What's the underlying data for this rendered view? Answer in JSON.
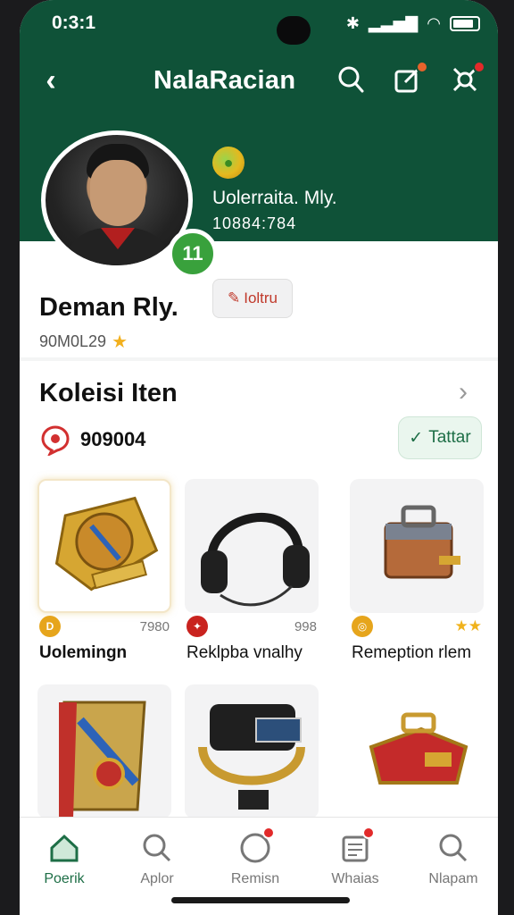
{
  "status_bar": {
    "time": "0:3:1"
  },
  "nav": {
    "title": "NalaRacian"
  },
  "header": {
    "subtitle": "Uolerraita. Mly.",
    "number": "10884:784",
    "level_badge": "11"
  },
  "profile": {
    "name": "Deman Rly.",
    "id": "90M0L29",
    "edit_label": "Ioltru"
  },
  "collection": {
    "title": "Koleisi Iten",
    "count": "909004",
    "filter_label": "Tattar",
    "items": [
      {
        "name": "Uolemingn",
        "value": "7980",
        "coin_color": "#e6a51c",
        "stars": ""
      },
      {
        "name": "Reklpba vnalhy",
        "value": "998",
        "coin_color": "#c9231f",
        "stars": ""
      },
      {
        "name": "Remeption rlem",
        "value": "",
        "coin_color": "#e6a51c",
        "stars": "★★"
      }
    ]
  },
  "bottom_nav": [
    {
      "label": "Poerik",
      "icon": "home-icon",
      "active": true
    },
    {
      "label": "Aplor",
      "icon": "search-icon",
      "active": false
    },
    {
      "label": "Remisn",
      "icon": "notification-icon",
      "active": false
    },
    {
      "label": "Whaias",
      "icon": "news-icon",
      "active": false
    },
    {
      "label": "Nlapam",
      "icon": "search-icon",
      "active": false
    }
  ],
  "colors": {
    "header": "#0f5238",
    "accent": "#1d6e46",
    "badge": "#e22a2a"
  }
}
